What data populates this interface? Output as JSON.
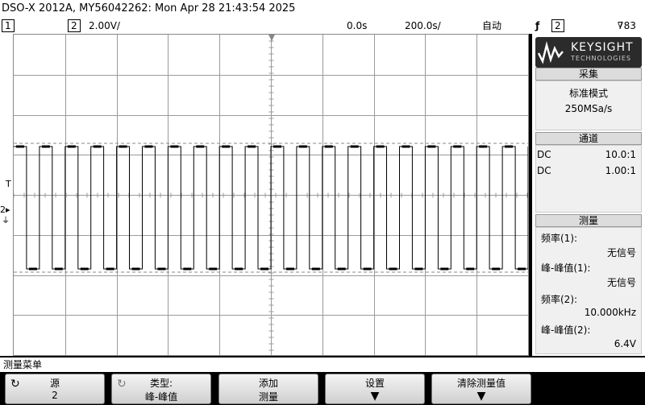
{
  "title": "DSO-X 2012A, MY56042262: Mon Apr 28 21:43:54 2025",
  "status": {
    "ch1": "1",
    "ch2": "2",
    "ch2_scale": "2.00V/",
    "delay": "0.0s",
    "timebase": "200.0s/",
    "trigger_mode": "自动",
    "trigger_icon": "trigger-edge-icon",
    "trigger_source": "2",
    "trigger_level": "783"
  },
  "logo": {
    "brand": "KEYSIGHT",
    "sub": "TECHNOLOGIES"
  },
  "acquisition": {
    "header": "采集",
    "mode": "标准模式",
    "rate": "250MSa/s"
  },
  "channels": {
    "header": "通道",
    "rows": [
      {
        "coupling": "DC",
        "probe": "10.0:1"
      },
      {
        "coupling": "DC",
        "probe": "1.00:1"
      }
    ]
  },
  "measurements": {
    "header": "测量",
    "items": [
      {
        "label": "频率(1):",
        "value": "无信号"
      },
      {
        "label": "峰-峰值(1):",
        "value": "无信号"
      },
      {
        "label": "频率(2):",
        "value": "10.000kHz"
      },
      {
        "label": "峰-峰值(2):",
        "value": "6.4V"
      }
    ]
  },
  "left_markers": {
    "trigger": "T",
    "ch2": "2"
  },
  "menu_title": "测量菜单",
  "softkeys": [
    {
      "line1": "源",
      "line2": "2"
    },
    {
      "line1": "类型:",
      "line2": "峰-峰值"
    },
    {
      "line1": "添加",
      "line2": "测量"
    },
    {
      "line1": "设置",
      "line2": ""
    },
    {
      "line1": "清除测量值",
      "line2": ""
    }
  ],
  "waveform": {
    "cycles": 20,
    "high_level_fraction": 0.35,
    "low_level_fraction": 0.73
  }
}
